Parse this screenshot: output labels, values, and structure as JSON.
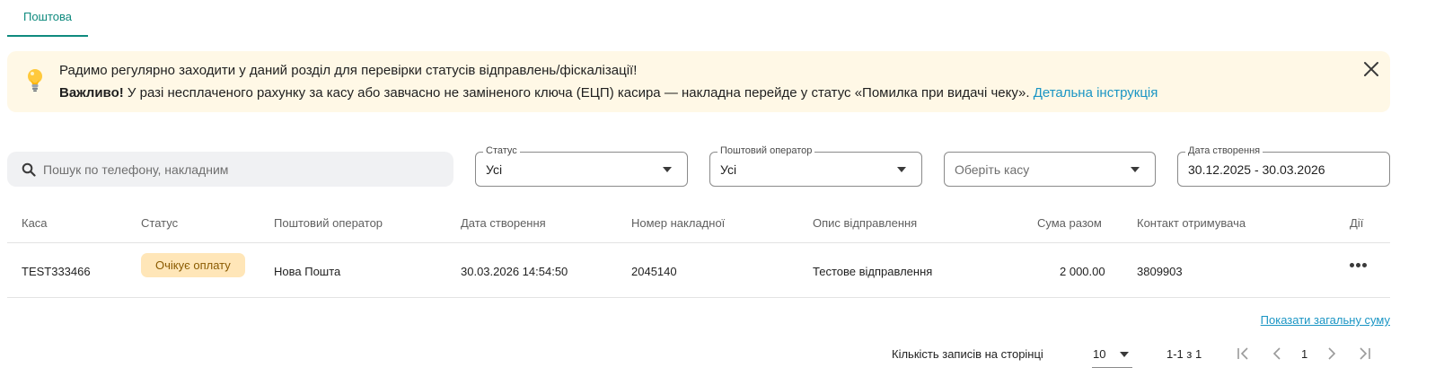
{
  "tabs": [
    {
      "label": "Поштова",
      "active": true
    }
  ],
  "alert": {
    "line1": "Радимо регулярно заходити у даний розділ для перевірки статусів відправлень/фіскалізації!",
    "line2_bold": "Важливо!",
    "line2_text": " У разі несплаченого рахунку за касу або завчасно не заміненого ключа (ЕЦП) касира — накладна перейде у статус «Помилка при видачі чеку». ",
    "link": "Детальна інструкція",
    "icon": "lightbulb-icon"
  },
  "filters": {
    "search_placeholder": "Пошук по телефону, накладним",
    "status": {
      "legend": "Статус",
      "value": "Усі"
    },
    "operator": {
      "legend": "Поштовий оператор",
      "value": "Усі"
    },
    "cashbox": {
      "placeholder": "Оберіть касу"
    },
    "date": {
      "legend": "Дата створення",
      "value": "30.12.2025 - 30.03.2026"
    }
  },
  "table": {
    "columns": [
      "Каса",
      "Статус",
      "Поштовий оператор",
      "Дата створення",
      "Номер накладної",
      "Опис відправлення",
      "Сума разом",
      "Контакт отримувача",
      "Дії"
    ],
    "rows": [
      {
        "kasa": "TEST333466",
        "status": "Очікує оплату",
        "operator": "Нова Пошта",
        "date": "30.03.2026 14:54:50",
        "number": "2045140",
        "description": "Тестове відправлення",
        "sum": "2 000.00",
        "contact": "3809903"
      }
    ]
  },
  "total_link": "Показати загальну суму",
  "pagination": {
    "rows_label": "Кількість записів на сторінці",
    "page_size": "10",
    "range": "1-1 з 1",
    "current_page": "1"
  },
  "colors": {
    "accent": "#0f8a7e",
    "link": "#1a95c4",
    "alert_bg": "#fff8e6",
    "badge_bg": "#ffe6b8"
  }
}
